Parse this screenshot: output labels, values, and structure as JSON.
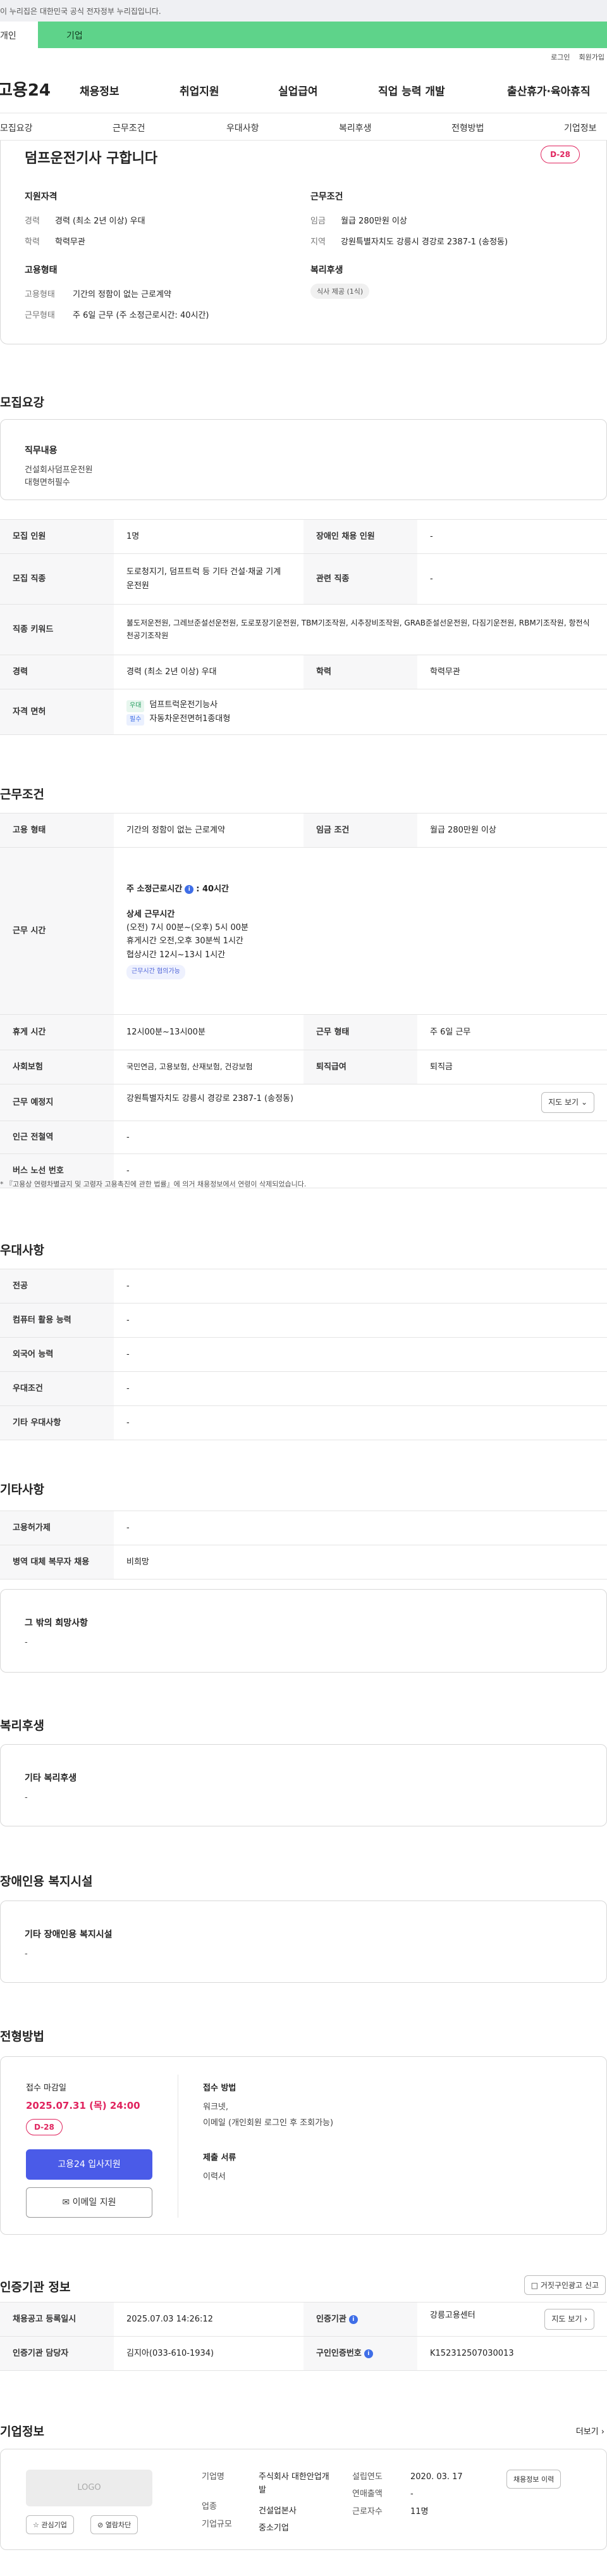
{
  "gov_notice": "이 누리집은 대한민국 공식 전자정부 누리집입니다.",
  "tabs": {
    "personal": "개인",
    "company": "기업"
  },
  "util": {
    "login": "로그인",
    "signup": "회원가입"
  },
  "logo": "고용24",
  "gnb": [
    "채용정보",
    "취업지원",
    "실업급여",
    "직업 능력 개발",
    "출산휴가·육아휴직"
  ],
  "anchors": [
    "모집요강",
    "근무조건",
    "우대사항",
    "복리후생",
    "전형방법",
    "기업정보"
  ],
  "summary": {
    "title": "덤프운전기사 구합니다",
    "dday": "D-28",
    "qual_title": "지원자격",
    "career_k": "경력",
    "career_v": "경력 (최소 2년 이상) 우대",
    "edu_k": "학력",
    "edu_v": "학력무관",
    "work_title": "근무조건",
    "wage_k": "임금",
    "wage_v": "월급 280만원 이상",
    "region_k": "지역",
    "region_v": "강원특별자치도 강릉시 경강로 2387-1 (송정동)",
    "emp_title": "고용형태",
    "emptype_k": "고용형태",
    "emptype_v": "기간의 정함이 없는 근로계약",
    "worktype_k": "근무형태",
    "worktype_v": "주 6일 근무 (주 소정근로시간: 40시간)",
    "welfare_title": "복리후생",
    "welfare_chip": "식사 제공 (1식)"
  },
  "recruit": {
    "title": "모집요강",
    "duty_label": "직무내용",
    "duty_lines": [
      "건설회사덤프운전원",
      "대형면허필수"
    ],
    "rows": {
      "count_k": "모집 인원",
      "count_v": "1명",
      "disabled_k": "장애인 채용 인원",
      "disabled_v": "-",
      "job_k": "모집 직종",
      "job_v": "도로청지기, 덤프트럭 등 기타 건설·채굴 기계 운전원",
      "related_k": "관련 직종",
      "related_v": "-",
      "kw_k": "직종 키워드",
      "kw_v": "불도저운전원, 그레브준설선운전원, 도로포장기운전원, TBM기조작원, 시추장비조작원, GRAB준설선운전원, 다짐기운전원, RBM기조작원, 항전식천공기조작원",
      "exp_k": "경력",
      "exp_v": "경력 (최소 2년 이상) 우대",
      "edu_k": "학력",
      "edu_v": "학력무관",
      "lic_k": "자격 면허",
      "lic1_badge": "우대",
      "lic1": "덤프트럭운전기능사",
      "lic2_badge": "필수",
      "lic2": "자동차운전면허1종대형"
    }
  },
  "work": {
    "title": "근무조건",
    "emp_k": "고용 형태",
    "emp_v": "기간의 정함이 없는 근로계약",
    "wage_k": "임금 조건",
    "wage_v": "월급 280만원 이상",
    "hours_k": "근무 시간",
    "hours_main": "주 소정근로시간",
    "hours_main_v": ": 40시간",
    "hours_detail_title": "상세 근무시간",
    "hours_lines": [
      "(오전) 7시 00분~(오후) 5시 00분",
      "휴게시간 오전,오후 30분씩 1시간",
      "협상시간 12시~13시 1시간"
    ],
    "hours_tag": "근무시간 협의가능",
    "rest_k": "휴게 시간",
    "rest_v": "12시00분~13시00분",
    "form_k": "근무 형태",
    "form_v": "주 6일 근무",
    "ins_k": "사회보험",
    "ins_v": "국민연금, 고용보험, 산재보험, 건강보험",
    "sev_k": "퇴직급여",
    "sev_v": "퇴직금",
    "loc_k": "근무 예정지",
    "loc_v": "강원특별자치도 강릉시 경강로 2387-1 (송정동)",
    "map_btn": "지도 보기",
    "sub_k": "인근 전철역",
    "sub_v": "-",
    "bus_k": "버스 노선 번호",
    "bus_v": "-",
    "note": "* 『고용상 연령차별금지 및 고령자 고용촉진에 관한 법률』에 의거 채용정보에서 연령이 삭제되었습니다."
  },
  "pref": {
    "title": "우대사항",
    "rows": [
      [
        "전공",
        "-"
      ],
      [
        "컴퓨터 활용 능력",
        "-"
      ],
      [
        "외국어 능력",
        "-"
      ],
      [
        "우대조건",
        "-"
      ],
      [
        "기타 우대사항",
        "-"
      ]
    ]
  },
  "etc": {
    "title": "기타사항",
    "rows": [
      [
        "고용허가제",
        "-"
      ],
      [
        "병역 대체 복무자 채용",
        "비희망"
      ]
    ],
    "wish_label": "그 밖의 희망사항",
    "wish_v": "-"
  },
  "welfare": {
    "title": "복리후생",
    "label": "기타 복리후생",
    "v": "-"
  },
  "disab": {
    "title": "장애인용 복지시설",
    "label": "기타 장애인용 복지시설",
    "v": "-"
  },
  "process": {
    "title": "전형방법",
    "deadline_label": "접수 마감일",
    "deadline": "2025.07.31 (목) 24:00",
    "dday": "D-28",
    "apply_btn": "고용24 입사지원",
    "mail_btn": "이메일 지원",
    "method_label": "접수 방법",
    "method_lines": [
      "워크넷,",
      "이메일 (개인회원 로그인 후 조회가능)"
    ],
    "docs_label": "제출 서류",
    "docs_v": "이력서"
  },
  "cert": {
    "title": "인증기관 정보",
    "report_btn": "거짓구인광고 신고",
    "reg_k": "채용공고 등록일시",
    "reg_v": "2025.07.03 14:26:12",
    "agency_k": "인증기관",
    "agency_v": "강릉고용센터",
    "map_btn": "지도 보기",
    "manager_k": "인증기관 담당자",
    "manager_v": "김지아(033-610-1934)",
    "num_k": "구인인증번호",
    "num_v": "K152312507030013"
  },
  "company": {
    "title": "기업정보",
    "more": "더보기",
    "logo_text": "LOGO",
    "fav_btn": "관심기업",
    "block_btn": "열람차단",
    "name_k": "기업명",
    "name_v": "주식회사 대한안업개발",
    "ind_k": "업종",
    "ind_v": "건설업본사",
    "size_k": "기업규모",
    "size_v": "중소기업",
    "est_k": "설립연도",
    "est_v": "2020. 03. 17",
    "sales_k": "연매출액",
    "sales_v": "-",
    "emp_k": "근로자수",
    "emp_v": "11명",
    "jobs_btn": "채용정보 이력"
  }
}
